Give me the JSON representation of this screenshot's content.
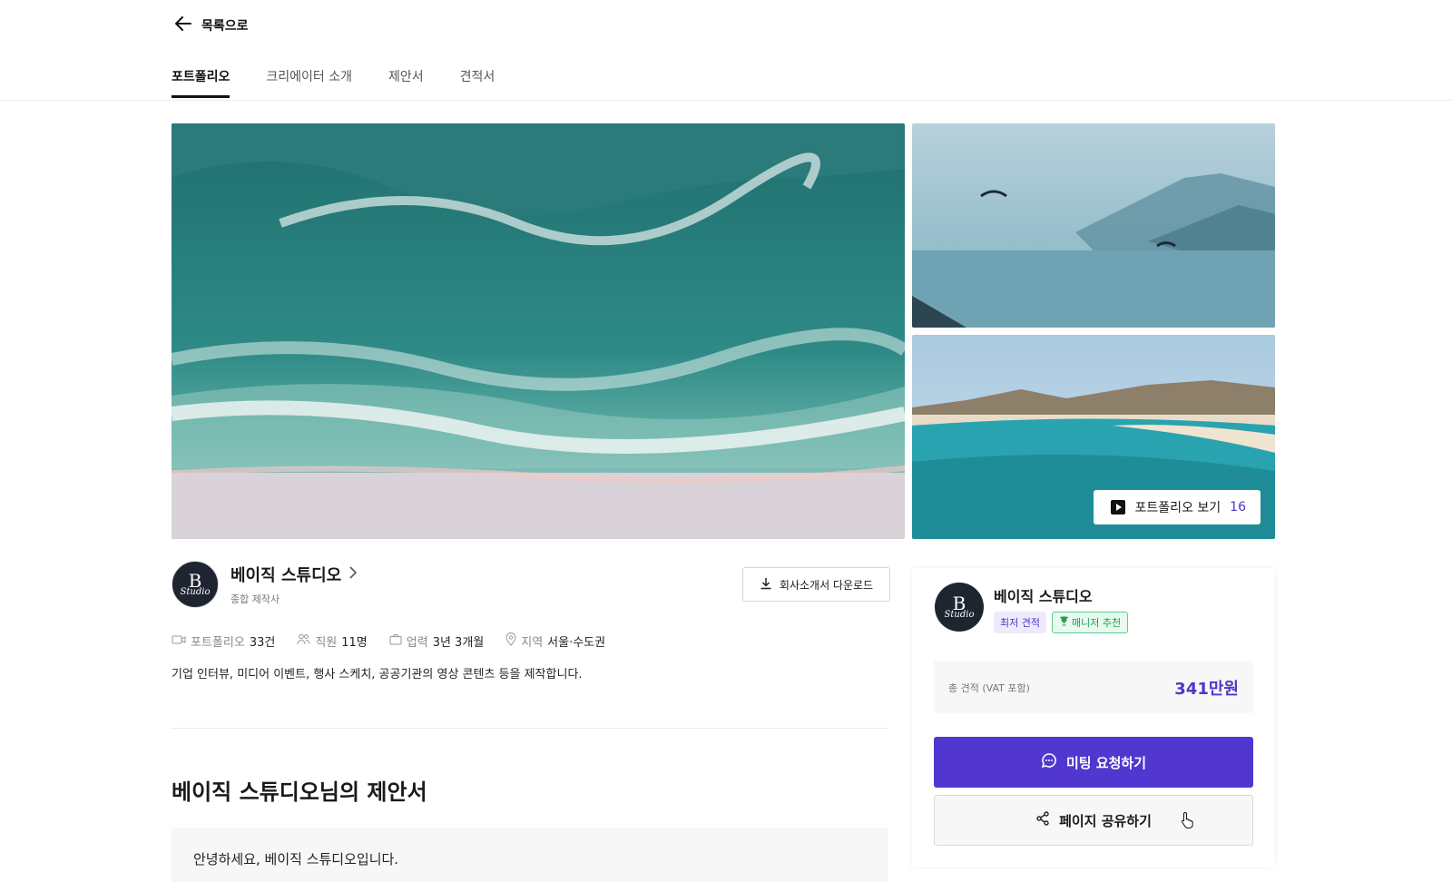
{
  "nav": {
    "back_label": "목록으로"
  },
  "tabs": [
    {
      "label": "포트폴리오",
      "active": true
    },
    {
      "label": "크리에이터 소개",
      "active": false
    },
    {
      "label": "제안서",
      "active": false
    },
    {
      "label": "견적서",
      "active": false
    }
  ],
  "gallery": {
    "portfolio_button_label": "포트폴리오 보기",
    "portfolio_count": "16"
  },
  "company": {
    "logo_letter": "B",
    "logo_word": "Studio",
    "name": "베이직 스튜디오",
    "type": "종합 제작사",
    "download_label": "회사소개서 다운로드",
    "stats": [
      {
        "icon": "video-icon",
        "key": "포트폴리오",
        "value": "33건"
      },
      {
        "icon": "people-icon",
        "key": "직원",
        "value": "11명"
      },
      {
        "icon": "briefcase-icon",
        "key": "업력",
        "value": "3년 3개월"
      },
      {
        "icon": "location-pin-icon",
        "key": "지역",
        "value": "서울·수도권"
      }
    ],
    "description": "기업 인터뷰, 미디어 이벤트, 행사 스케치, 공공기관의 영상 콘텐츠 등을 제작합니다."
  },
  "proposal": {
    "title": "베이직 스튜디오님의 제안서",
    "greeting": "안녕하세요, 베이직 스튜디오입니다."
  },
  "sidebar": {
    "name": "베이직 스튜디오",
    "badge_lowest": "최저 견적",
    "badge_manager": "매니저 추천",
    "price_label": "총 견적 (VAT 포함)",
    "price_value": "341만원",
    "meeting_label": "미팅 요청하기",
    "share_label": "페이지 공유하기"
  },
  "colors": {
    "accent": "#5137d0",
    "accent_text": "#4e36c7",
    "badge_green": "#1f9d55"
  }
}
